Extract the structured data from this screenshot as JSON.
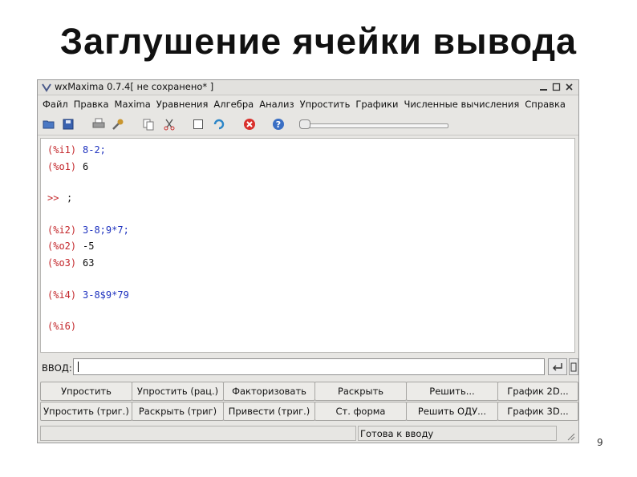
{
  "slide": {
    "title": "Заглушение ячейки вывода",
    "page_number": "9"
  },
  "window": {
    "title": "wxMaxima 0.7.4[ не сохранено* ]",
    "icons": [
      "app-icon",
      "minimize-icon",
      "maximize-icon",
      "close-icon"
    ]
  },
  "menu": [
    "Файл",
    "Правка",
    "Maxima",
    "Уравнения",
    "Алгебра",
    "Анализ",
    "Упростить",
    "Графики",
    "Численные вычисления",
    "Справка"
  ],
  "toolbar": {
    "icons": [
      "open-icon",
      "save-icon",
      "print-icon",
      "preferences-icon",
      "copy-icon",
      "cut-icon",
      "select-all-icon",
      "refresh-icon",
      "interrupt-icon",
      "help-icon"
    ],
    "slider": {
      "value": 0
    }
  },
  "worksheet": {
    "lines": [
      {
        "label": "(%i1)",
        "text": "8-2;",
        "kind": "input"
      },
      {
        "label": "(%o1)",
        "text": "6",
        "kind": "output"
      },
      {
        "label": ">>",
        "text": ";",
        "kind": "prompt"
      },
      {
        "label": "(%i2)",
        "text": "3-8;9*7;",
        "kind": "input"
      },
      {
        "label": "(%o2)",
        "text": "-5",
        "kind": "output"
      },
      {
        "label": "(%o3)",
        "text": "63",
        "kind": "output"
      },
      {
        "label": "(%i4)",
        "text": "3-8$9*79",
        "kind": "input"
      },
      {
        "label": "(%i6)",
        "text": "",
        "kind": "input"
      }
    ]
  },
  "input_row": {
    "label": "ВВОД:",
    "value": ""
  },
  "buttons": [
    [
      "Упростить",
      "Упростить (рац.)",
      "Факторизовать",
      "Раскрыть",
      "Решить...",
      "График 2D..."
    ],
    [
      "Упростить (триг.)",
      "Раскрыть (триг)",
      "Привести (триг.)",
      "Ст. форма",
      "Решить ОДУ...",
      "График 3D..."
    ]
  ],
  "status": {
    "text": "Готова к вводу"
  },
  "colors": {
    "label": "#c3262a",
    "input_text": "#1f33bf",
    "output_text": "#111111"
  }
}
